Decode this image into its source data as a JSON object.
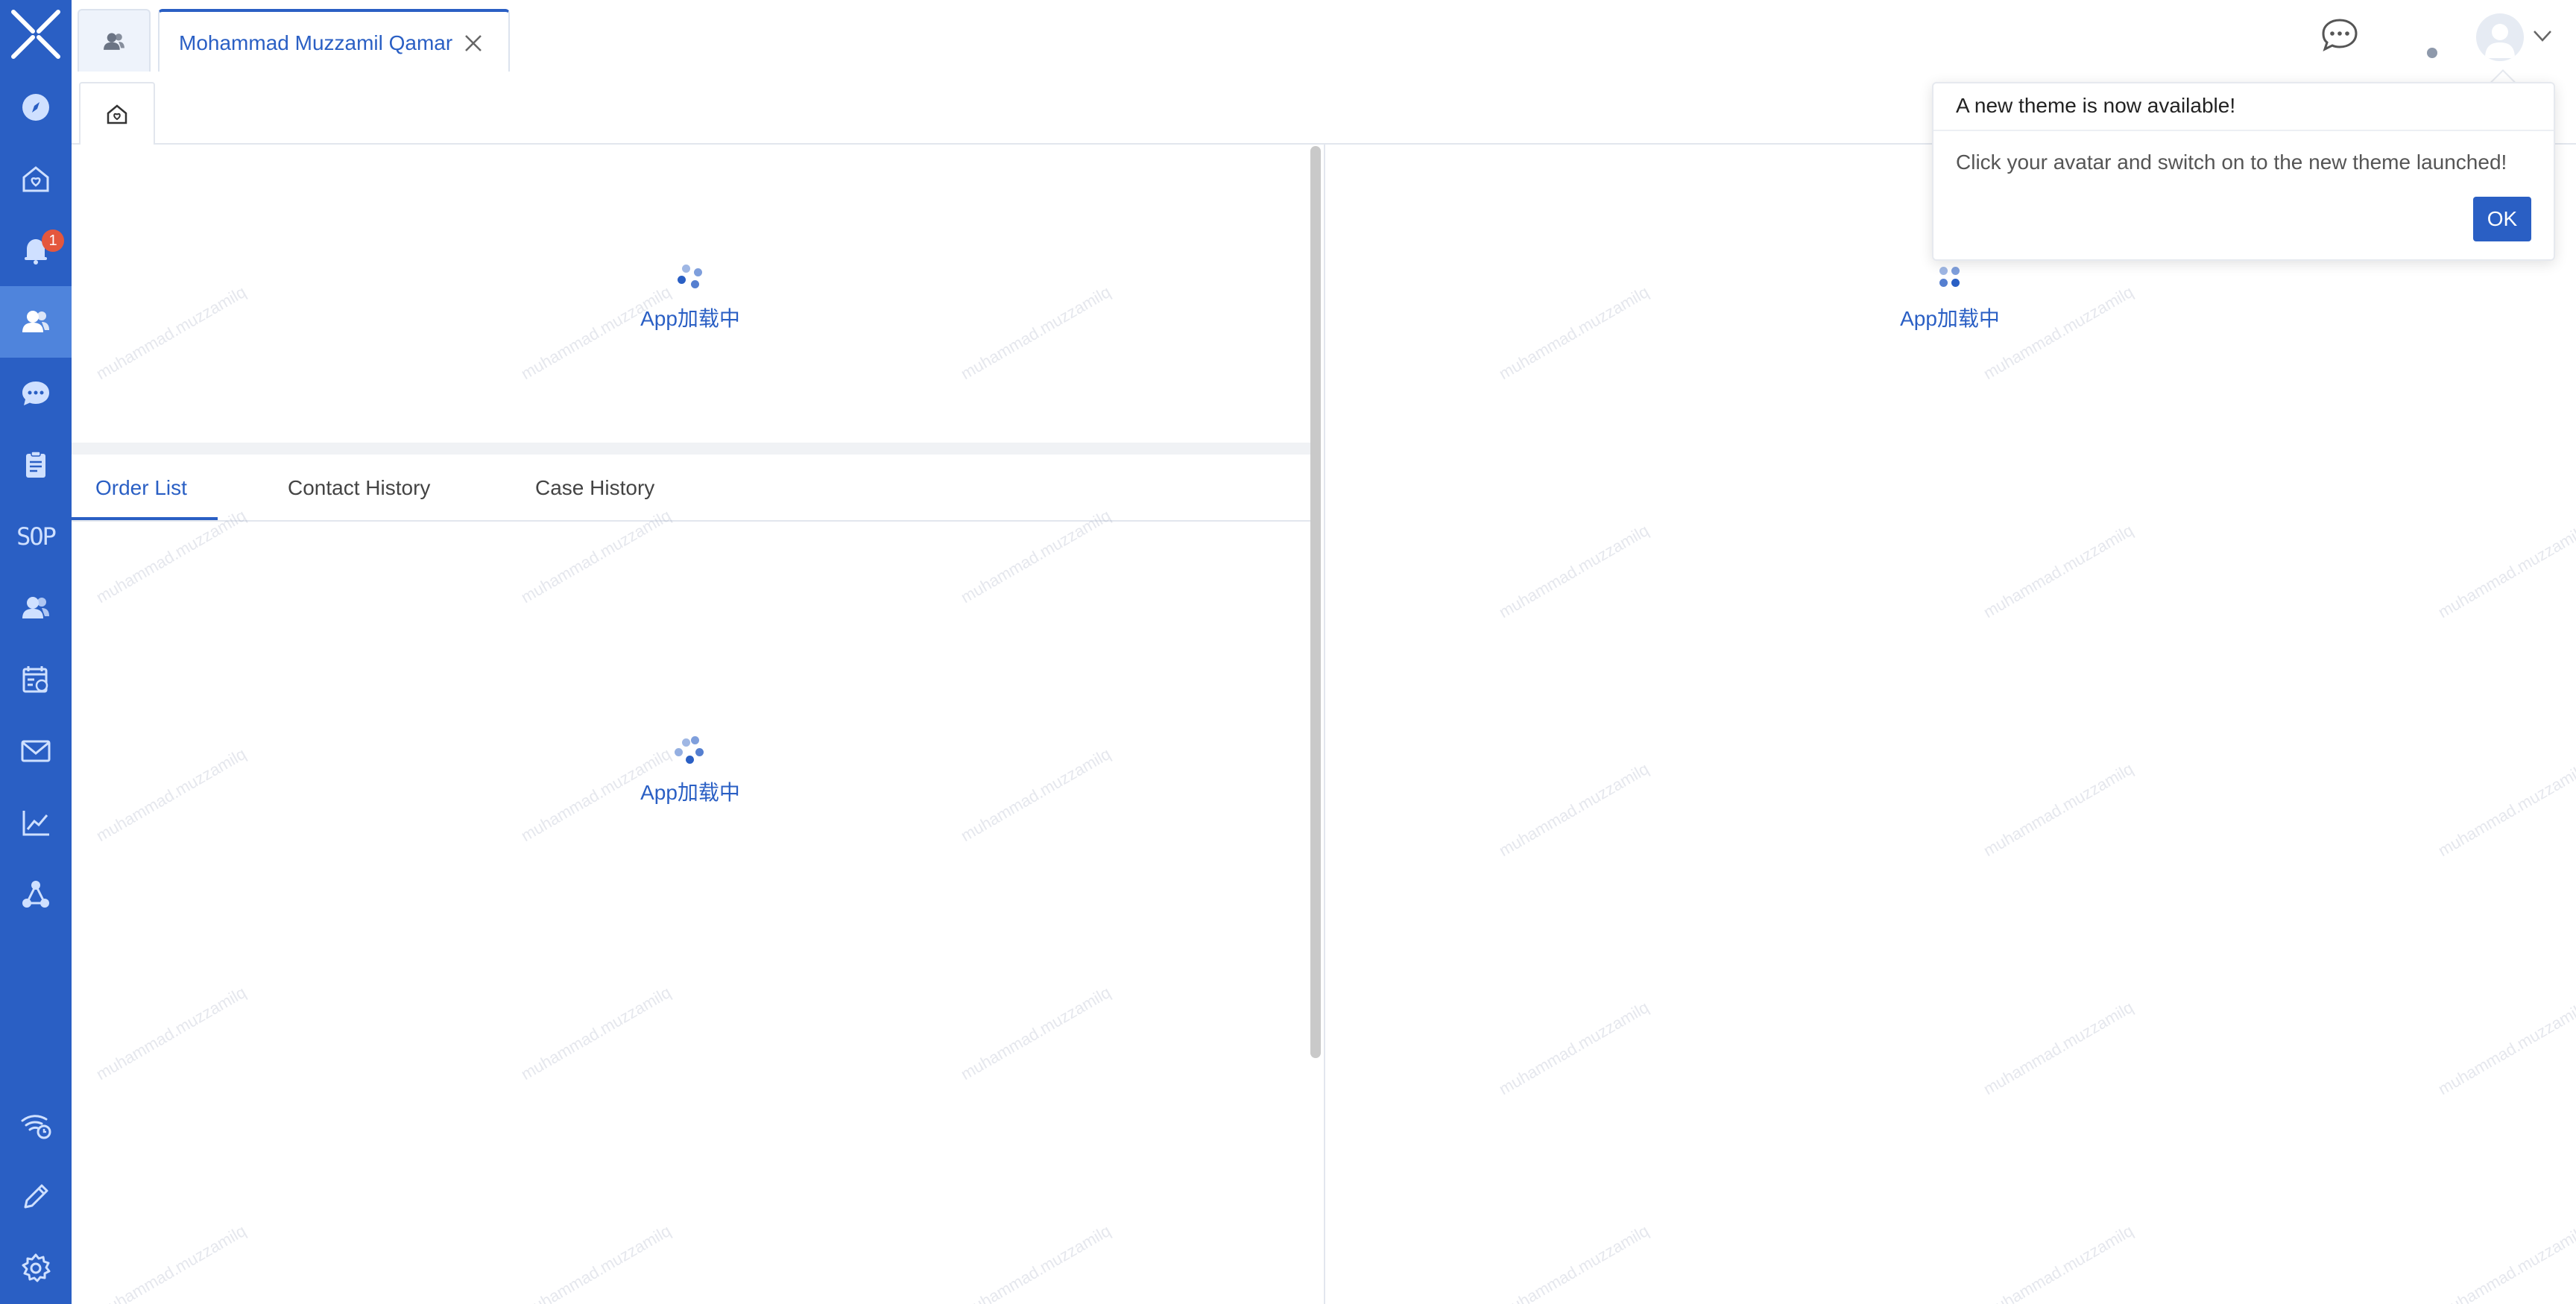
{
  "sidebar": {
    "notification_badge": "1",
    "sop_label": "SOP",
    "items": [
      {
        "icon": "compass-icon"
      },
      {
        "icon": "home-heart-icon"
      },
      {
        "icon": "bell-icon"
      },
      {
        "icon": "customers-icon"
      },
      {
        "icon": "chat-bubble-icon"
      },
      {
        "icon": "clipboard-icon"
      },
      {
        "icon": "sop-icon"
      },
      {
        "icon": "users-icon"
      },
      {
        "icon": "schedule-icon"
      },
      {
        "icon": "mail-icon"
      },
      {
        "icon": "line-chart-icon"
      },
      {
        "icon": "network-icon"
      },
      {
        "icon": "wifi-status-icon"
      },
      {
        "icon": "pencil-icon"
      },
      {
        "icon": "settings-gear-icon"
      }
    ]
  },
  "topbar": {
    "active_tab_label": "Mohammad Muzzamil Qamar"
  },
  "left_panel": {
    "loading_top": "App加载中",
    "loading_bottom": "App加载中",
    "tabs": [
      {
        "label": "Order List"
      },
      {
        "label": "Contact History"
      },
      {
        "label": "Case History"
      }
    ]
  },
  "right_panel": {
    "loading": "App加载中"
  },
  "watermark_text": "muhammad.muzzamilq",
  "popover": {
    "title": "A new theme is now available!",
    "body": "Click your avatar and switch on to the new theme launched!",
    "ok_label": "OK"
  },
  "colors": {
    "sidebar_bg": "#2a5fc4",
    "sidebar_active": "#4f84dc",
    "accent": "#2a5fc4",
    "badge": "#e4573d"
  }
}
